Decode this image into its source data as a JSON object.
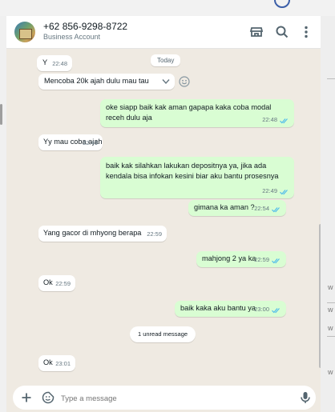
{
  "contact": {
    "name": "+62 856-9298-8722",
    "subtitle": "Business Account"
  },
  "date_badge": "Today",
  "messages": [
    {
      "dir": "in",
      "text": "Y",
      "time": "22:48"
    },
    {
      "dir": "in",
      "text": "Mencoba 20k ajah dulu mau tau",
      "time": ""
    },
    {
      "dir": "out",
      "text": "oke siapp baik kak aman gapapa kaka coba modal receh dulu aja",
      "time": "22:48",
      "status": "read"
    },
    {
      "dir": "in",
      "text": "Yy mau coba ajah",
      "time": "22:49"
    },
    {
      "dir": "out",
      "text": "baik kak silahkan lakukan depositnya ya, jika ada kendala bisa infokan kesini biar aku bantu prosesnya",
      "time": "22:49",
      "status": "read"
    },
    {
      "dir": "out",
      "text": "gimana ka aman ?",
      "time": "22:54",
      "status": "read"
    },
    {
      "dir": "in",
      "text": "Yang gacor di mhyong berapa",
      "time": "22:59"
    },
    {
      "dir": "out",
      "text": "mahjong 2 ya ka",
      "time": "22:59",
      "status": "read"
    },
    {
      "dir": "in",
      "text": "Ok",
      "time": "22:59"
    },
    {
      "dir": "out",
      "text": "baik kaka aku bantu ya",
      "time": "23:00",
      "status": "read"
    },
    {
      "dir": "in",
      "text": "Ok",
      "time": "23:01"
    }
  ],
  "unread_label": "1 unread message",
  "composer": {
    "placeholder": "Type a message"
  },
  "icons": {
    "header": [
      "store-icon",
      "search-icon",
      "menu-icon"
    ],
    "composer": [
      "plus-icon",
      "sticker-icon",
      "mic-icon"
    ]
  },
  "colors": {
    "outgoing_bubble": "#d9fdd3",
    "incoming_bubble": "#ffffff",
    "chat_background": "#efeae2",
    "read_ticks": "#53bdeb"
  },
  "side_letters": [
    "w",
    "w",
    "w",
    "w"
  ]
}
